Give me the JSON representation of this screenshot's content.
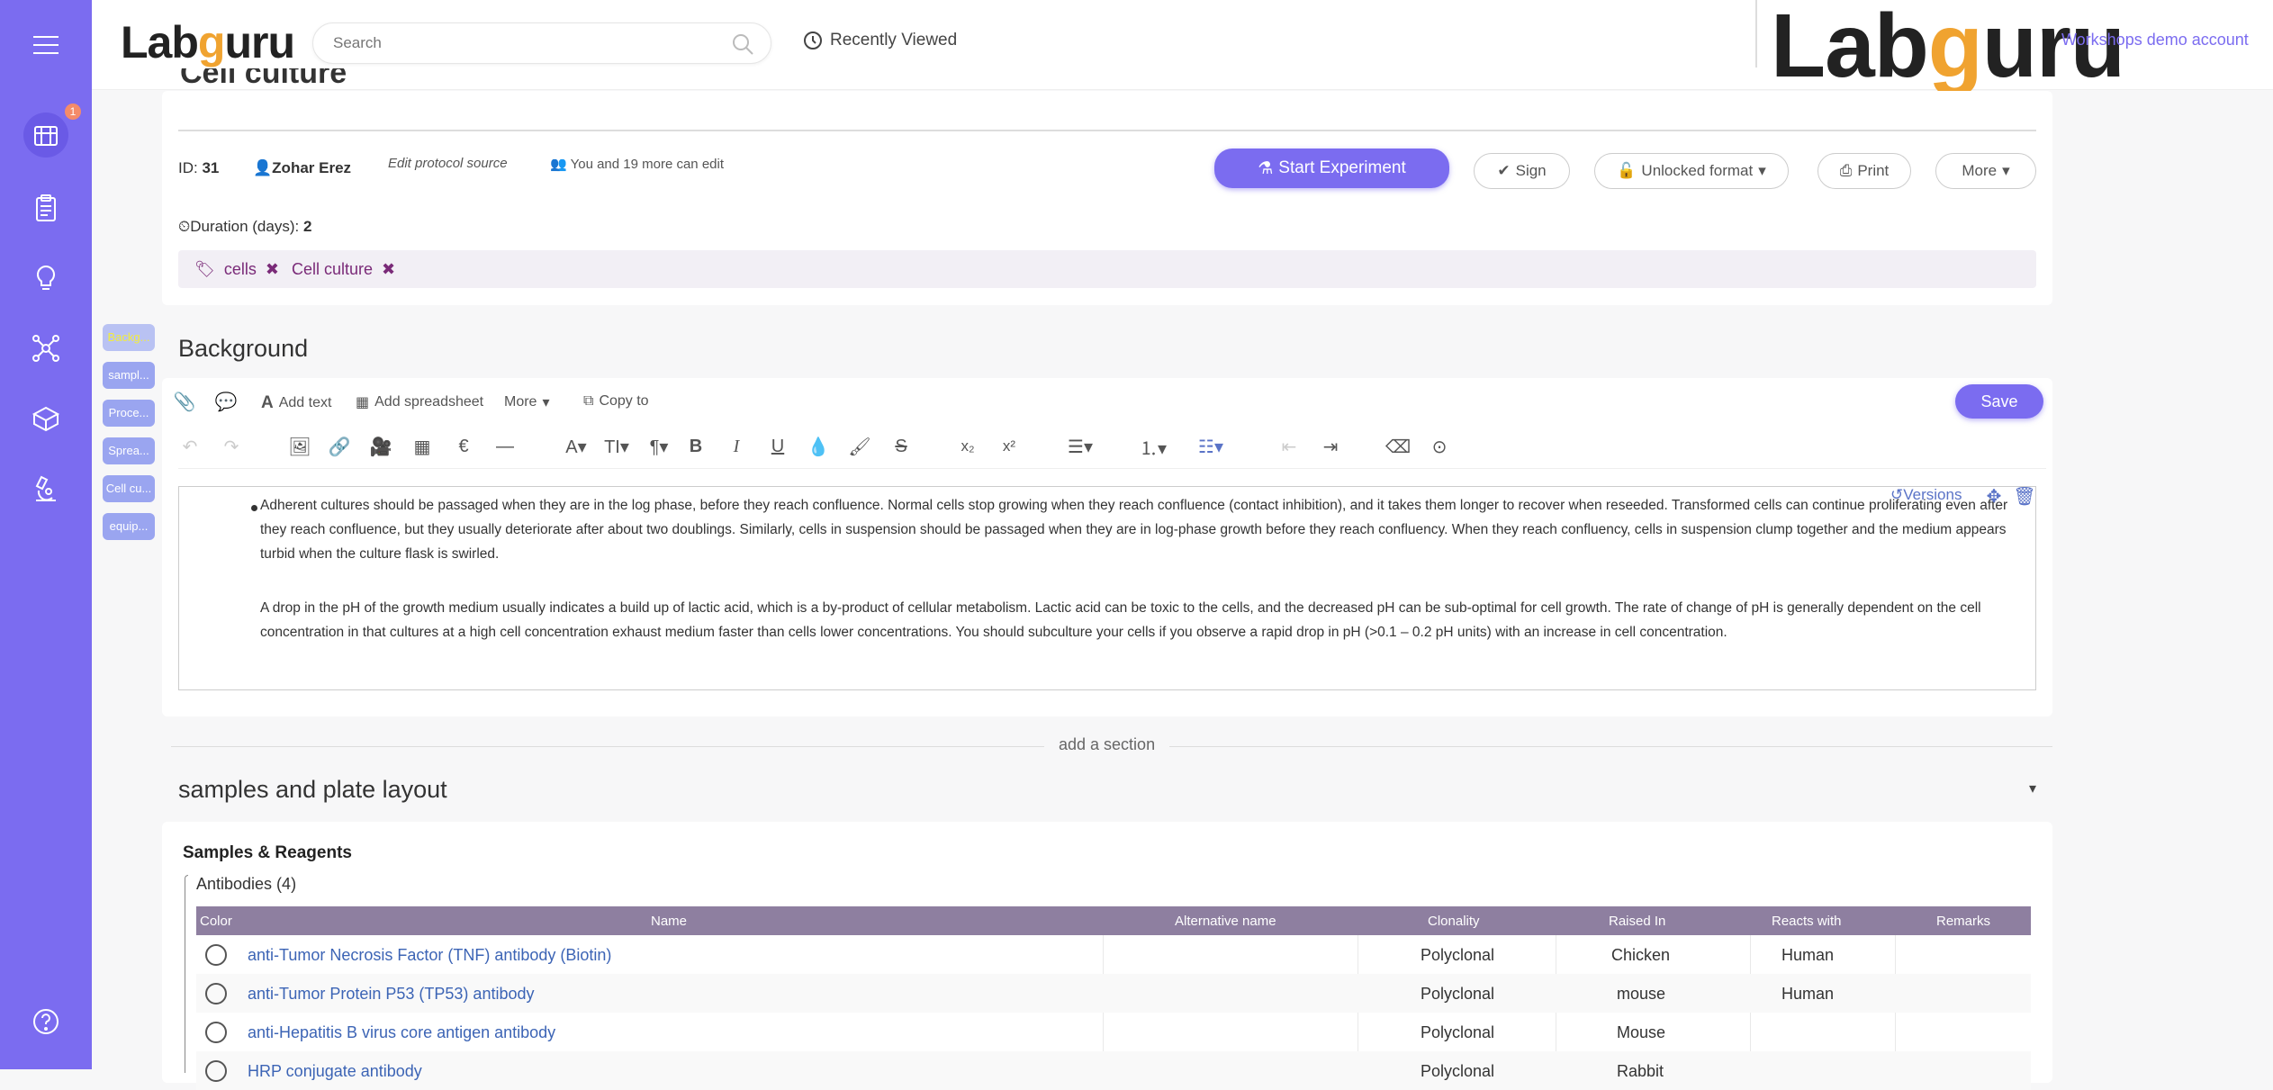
{
  "brand": {
    "logo_left": "Labguru",
    "logo_right": "Labguru",
    "account": "Workshops demo account"
  },
  "sidebar": {
    "notification_count": "1",
    "help_label": "?"
  },
  "search": {
    "placeholder": "Search"
  },
  "topbar": {
    "recently_viewed": "Recently Viewed"
  },
  "protocol": {
    "title": "Cell culture",
    "id_label": "ID:",
    "id_value": "31",
    "owner": "Zohar Erez",
    "edit_source": "Edit protocol source",
    "editors": "You and 19 more can edit",
    "duration_label": "Duration (days):",
    "duration_value": "2",
    "tags": [
      "cells",
      "Cell culture"
    ]
  },
  "actions": {
    "start_experiment": "Start Experiment",
    "sign": "Sign",
    "unlocked_format": "Unlocked format",
    "print": "Print",
    "more": "More"
  },
  "section_nav": [
    "Backg...",
    "sampl...",
    "Proce...",
    "Sprea...",
    "Cell cu...",
    "equip..."
  ],
  "background": {
    "title": "Background",
    "toolbar": {
      "add_text": "Add text",
      "add_spreadsheet": "Add spreadsheet",
      "more": "More",
      "copy_to": "Copy to",
      "save": "Save"
    },
    "versions": "Versions",
    "paragraph1": "Adherent cultures should be passaged when they are in the log phase, before they reach confluence.  Normal cells stop growing when they reach confluence (contact inhibition), and it takes them longer to recover when reseeded.  Transformed cells can continue proliferating even after they reach confluence, but they usually deteriorate after about two doublings. Similarly, cells in suspension should be passaged when they are in log-phase growth before they reach confluency.  When they reach confluency, cells in suspension clump together and the medium appears turbid when the culture flask is swirled.",
    "paragraph2": "A drop in the pH of the growth medium usually indicates a build up of lactic acid, which is a by-product of cellular metabolism.  Lactic acid can be toxic to the cells, and the decreased pH can be sub-optimal for cell growth.  The rate of change of pH is generally dependent on the cell concentration in that cultures at a high cell concentration exhaust medium faster than cells lower concentrations.  You should subculture your cells if you observe a rapid drop in pH (>0.1 – 0.2 pH units) with an increase in cell concentration."
  },
  "add_section": "add a section",
  "samples": {
    "title": "samples and plate layout",
    "subtitle": "Samples & Reagents",
    "group": "Antibodies (4)",
    "columns": [
      "Color",
      "Name",
      "Alternative name",
      "Clonality",
      "Raised In",
      "Reacts with",
      "Remarks"
    ],
    "rows": [
      {
        "name": "anti-Tumor Necrosis Factor (TNF) antibody (Biotin)",
        "alt": "",
        "clonality": "Polyclonal",
        "raised": "Chicken",
        "reacts": "Human",
        "remarks": ""
      },
      {
        "name": "anti-Tumor Protein P53 (TP53) antibody",
        "alt": "",
        "clonality": "Polyclonal",
        "raised": "mouse",
        "reacts": "Human",
        "remarks": ""
      },
      {
        "name": "anti-Hepatitis B virus core antigen antibody",
        "alt": "",
        "clonality": "Polyclonal",
        "raised": "Mouse",
        "reacts": "",
        "remarks": ""
      },
      {
        "name": "HRP conjugate antibody",
        "alt": "",
        "clonality": "Polyclonal",
        "raised": "Rabbit",
        "reacts": "",
        "remarks": ""
      }
    ]
  },
  "colors": {
    "accent": "#7b6cf0",
    "tag_text": "#7a2a78",
    "link": "#3c64b5",
    "table_header": "#8e7fa0"
  }
}
